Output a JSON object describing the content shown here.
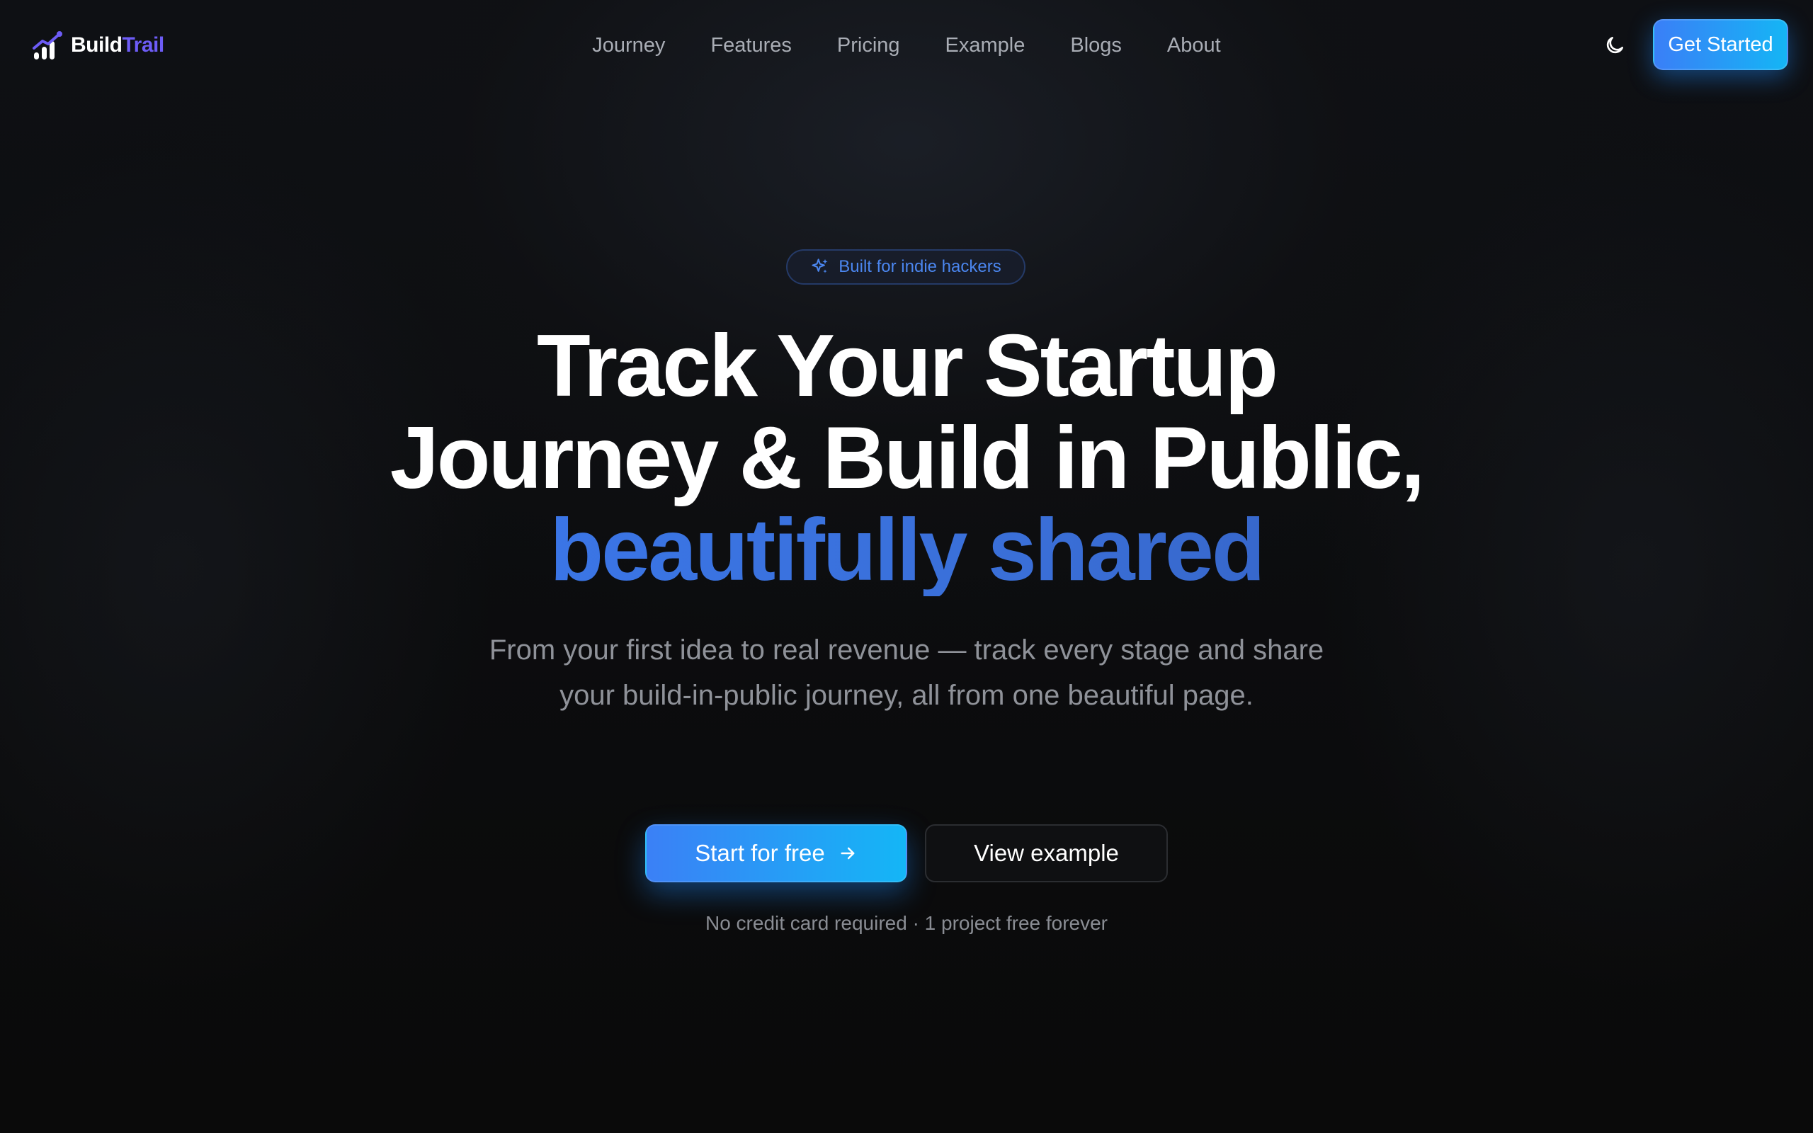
{
  "nav": {
    "logo": {
      "word_primary": "Build",
      "word_accent": "Trail",
      "icon": "bar-chart-trend-icon",
      "accent_color": "#6d5cf6"
    },
    "links": [
      "Journey",
      "Features",
      "Pricing",
      "Example",
      "Blogs",
      "About"
    ],
    "theme_toggle_icon": "moon-icon",
    "cta_label": "Get Started"
  },
  "hero": {
    "badge_icon": "sparkles-icon",
    "badge_text": "Built for indie hackers",
    "headline_line1": "Track Your Startup",
    "headline_line2": "Journey & Build in Public,",
    "headline_accent": "beautifully shared",
    "subheadline": "From your first idea to real revenue — track every stage and share your build-in-public journey, all from one beautiful page.",
    "primary_cta": "Start for free",
    "primary_cta_icon": "arrow-right-icon",
    "secondary_cta": "View example",
    "fineprint": "No credit card required · 1 project free forever"
  },
  "colors": {
    "background": "#0b0b0c",
    "accent_blue": "#3b78ec",
    "button_gradient_start": "#3b80f6",
    "button_gradient_end": "#14b6f6",
    "muted_text": "#8f9299"
  }
}
